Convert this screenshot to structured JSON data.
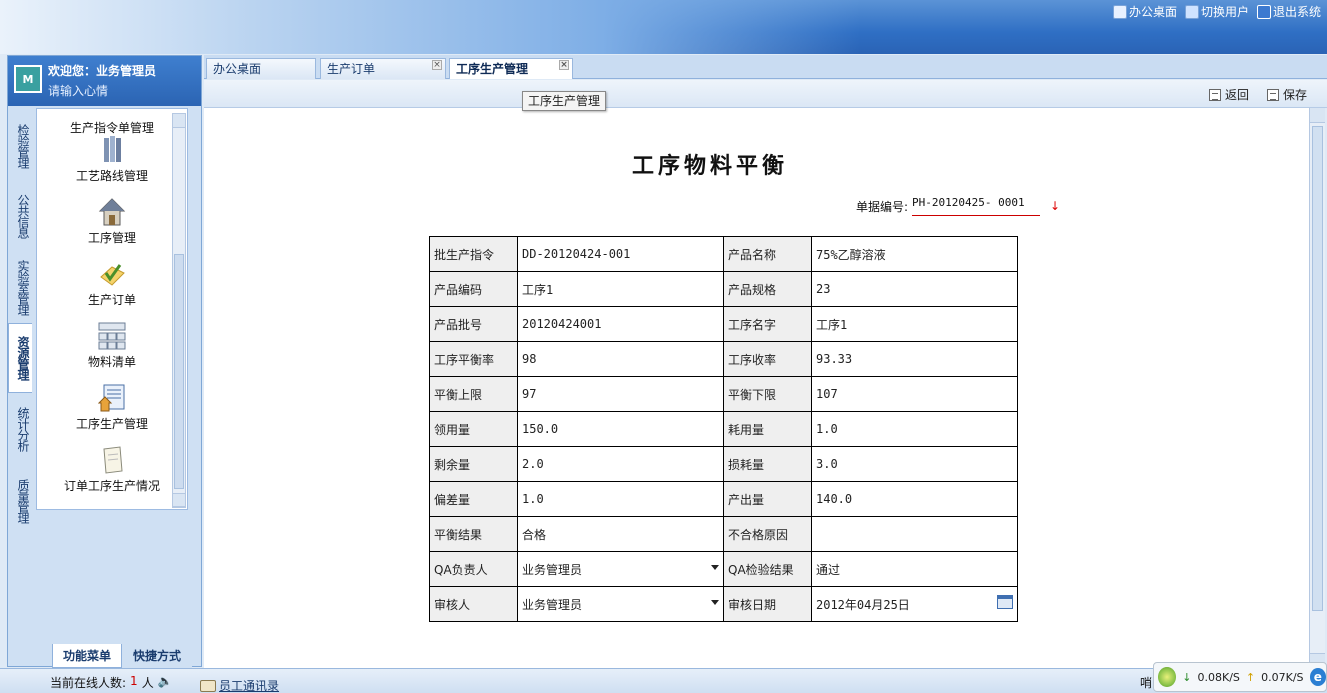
{
  "top_links": [
    {
      "label": "办公桌面",
      "icon": "home-icon"
    },
    {
      "label": "切换用户",
      "icon": "switch-user-icon"
    },
    {
      "label": "退出系统",
      "icon": "exit-icon"
    }
  ],
  "welcome": {
    "title": "欢迎您：业务管理员",
    "subtitle": "请输入心情",
    "logo": "M"
  },
  "vertical_tabs": [
    "检验管理",
    "公共信息",
    "实验室管理",
    "资源管理",
    "统计分析",
    "质量管理"
  ],
  "active_vertical_tab": "资源管理",
  "menu": {
    "first": "生产指令单管理",
    "items": [
      {
        "label": "工艺路线管理",
        "icon": "route-icon"
      },
      {
        "label": "工序管理",
        "icon": "house-icon"
      },
      {
        "label": "生产订单",
        "icon": "order-check-icon"
      },
      {
        "label": "物料清单",
        "icon": "bom-icon"
      },
      {
        "label": "工序生产管理",
        "icon": "process-production-icon"
      },
      {
        "label": "订单工序生产情况",
        "icon": "note-icon"
      }
    ]
  },
  "bottom_tabs": [
    "功能菜单",
    "快捷方式"
  ],
  "tabs": [
    {
      "label": "办公桌面",
      "closable": false
    },
    {
      "label": "生产订单",
      "closable": true
    },
    {
      "label": "工序生产管理",
      "closable": true,
      "active": true
    }
  ],
  "tooltip": "工序生产管理",
  "toolbar": {
    "back": "返回",
    "save": "保存"
  },
  "form": {
    "title": "工序物料平衡",
    "doc_no_label": "单据编号:",
    "doc_no": "PH-20120425- 0001",
    "rows": [
      [
        {
          "label": "批生产指令",
          "value": "DD-20120424-001"
        },
        {
          "label": "产品名称",
          "value": "75%乙醇溶液"
        }
      ],
      [
        {
          "label": "产品编码",
          "value": "工序1"
        },
        {
          "label": "产品规格",
          "value": "23"
        }
      ],
      [
        {
          "label": "产品批号",
          "value": "20120424001"
        },
        {
          "label": "工序名字",
          "value": "工序1"
        }
      ],
      [
        {
          "label": "工序平衡率",
          "value": "98"
        },
        {
          "label": "工序收率",
          "value": "93.33"
        }
      ],
      [
        {
          "label": "平衡上限",
          "value": "97"
        },
        {
          "label": "平衡下限",
          "value": "107"
        }
      ],
      [
        {
          "label": "领用量",
          "value": "150.0"
        },
        {
          "label": "耗用量",
          "value": "1.0"
        }
      ],
      [
        {
          "label": "剩余量",
          "value": "2.0"
        },
        {
          "label": "损耗量",
          "value": "3.0"
        }
      ],
      [
        {
          "label": "偏差量",
          "value": "1.0"
        },
        {
          "label": "产出量",
          "value": "140.0"
        }
      ],
      [
        {
          "label": "平衡结果",
          "value": "合格"
        },
        {
          "label": "不合格原因",
          "value": ""
        }
      ],
      [
        {
          "label": "QA负责人",
          "value": "业务管理员",
          "select": true
        },
        {
          "label": "QA检验结果",
          "value": "通过"
        }
      ],
      [
        {
          "label": "审核人",
          "value": "业务管理员",
          "select": true
        },
        {
          "label": "审核日期",
          "value": "2012年04月25日",
          "calendar": true
        }
      ]
    ]
  },
  "status": {
    "online_label": "当前在线人数:",
    "online_count": "1",
    "online_unit": "人",
    "contact": "员工通讯录",
    "net_down": "0.08K/S",
    "net_up": "0.07K/S",
    "edge_text": "哨"
  },
  "colors": {
    "accent": "#2f6fc4",
    "arrow": "#dd0000"
  }
}
